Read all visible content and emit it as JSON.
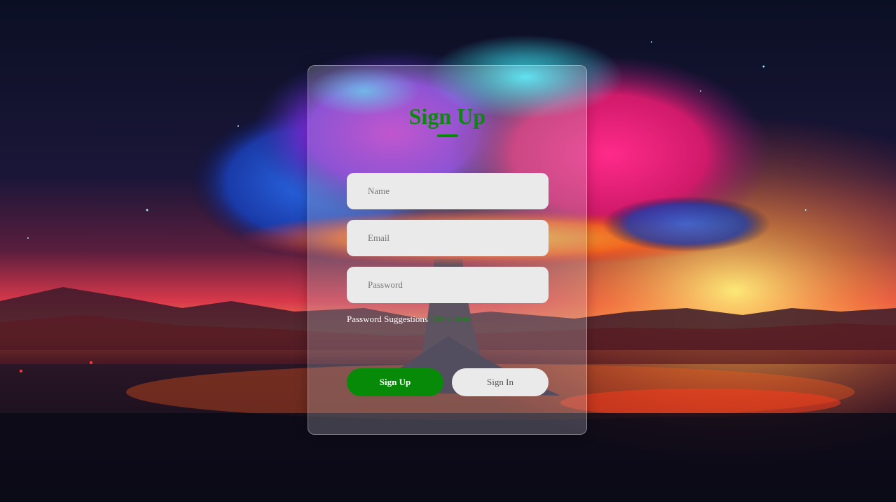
{
  "form": {
    "title": "Sign Up",
    "fields": {
      "name_placeholder": "Name",
      "email_placeholder": "Email",
      "password_placeholder": "Password",
      "name_value": "",
      "email_value": "",
      "password_value": ""
    },
    "suggestion": {
      "text": "Password Suggestions",
      "link_label": "Click Here"
    },
    "buttons": {
      "signup_label": "Sign Up",
      "signin_label": "Sign In"
    }
  },
  "colors": {
    "accent": "#078a07",
    "field_bg": "#eaeaea"
  }
}
